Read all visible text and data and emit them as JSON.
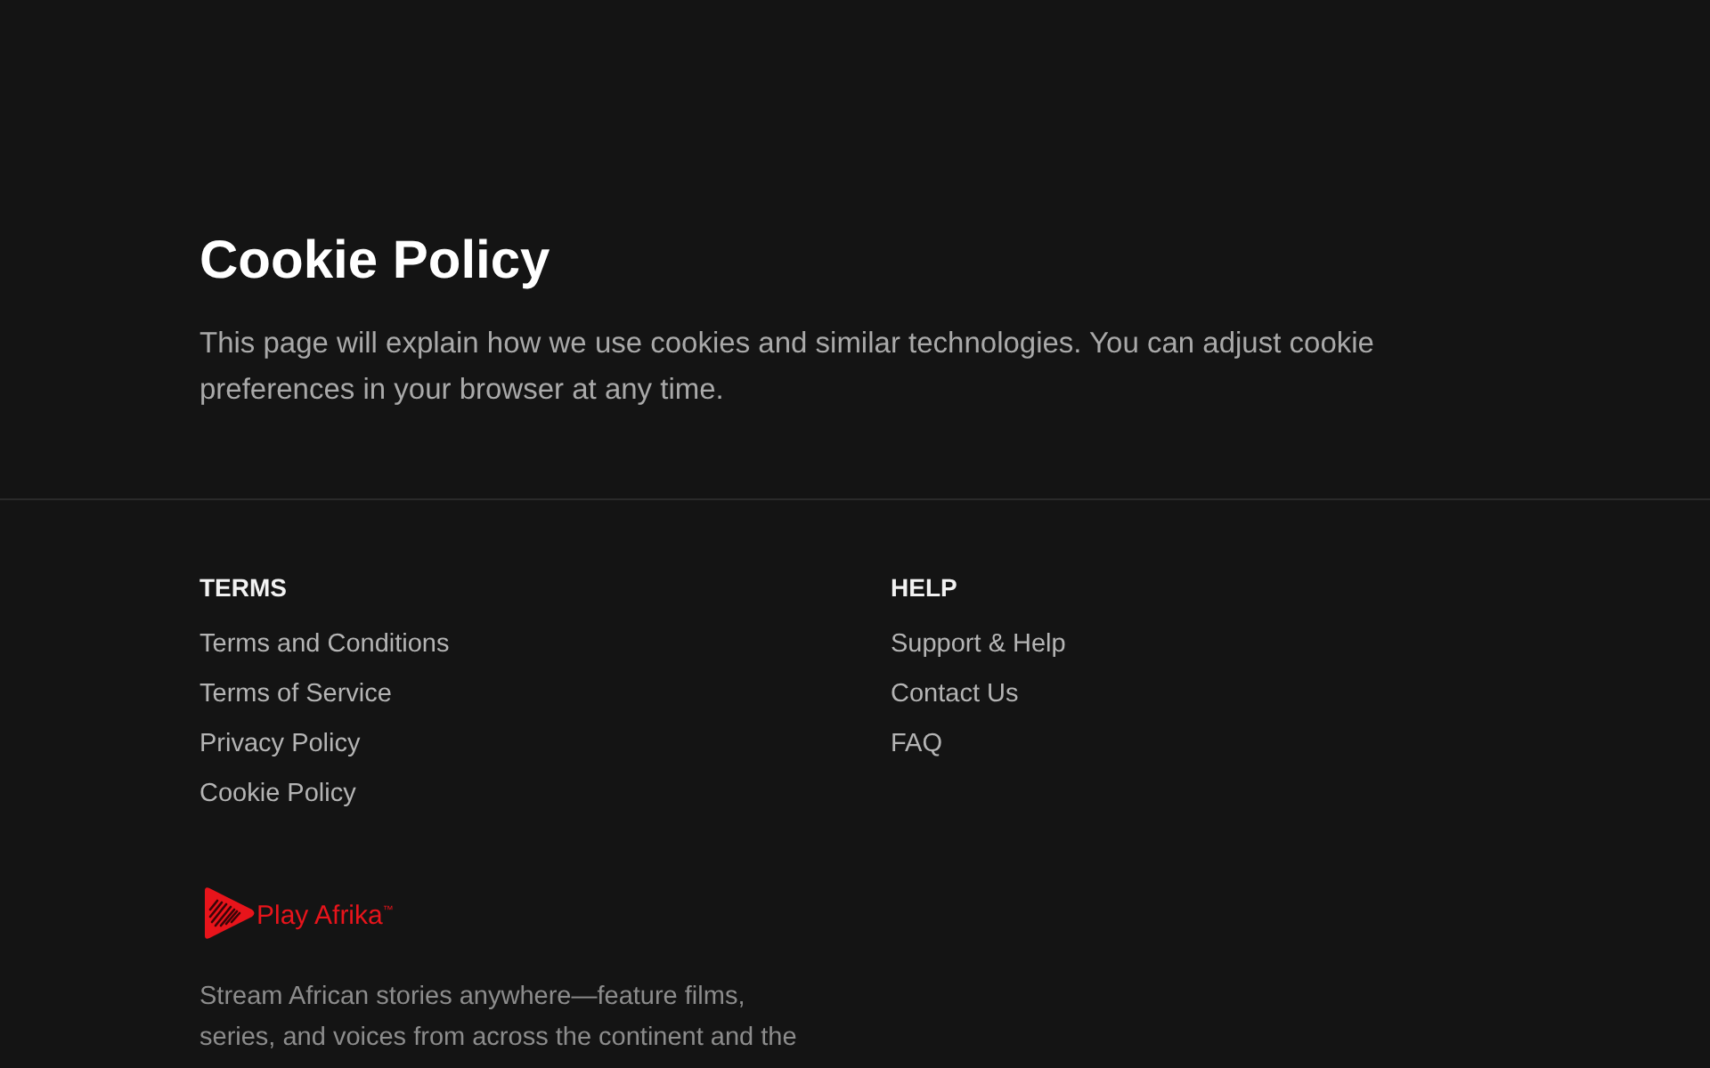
{
  "page": {
    "title": "Cookie Policy",
    "intro": "This page will explain how we use cookies and similar technologies. You can adjust cookie preferences in your browser at any time."
  },
  "footer": {
    "columns": [
      {
        "heading": "TERMS",
        "links": [
          "Terms and Conditions",
          "Terms of Service",
          "Privacy Policy",
          "Cookie Policy"
        ]
      },
      {
        "heading": "HELP",
        "links": [
          "Support & Help",
          "Contact Us",
          "FAQ"
        ]
      }
    ],
    "brand": {
      "name": "Play Afrika$^{™}$",
      "tagline": "Stream African stories anywhere—feature films, series, and voices from across the continent and the"
    }
  }
}
